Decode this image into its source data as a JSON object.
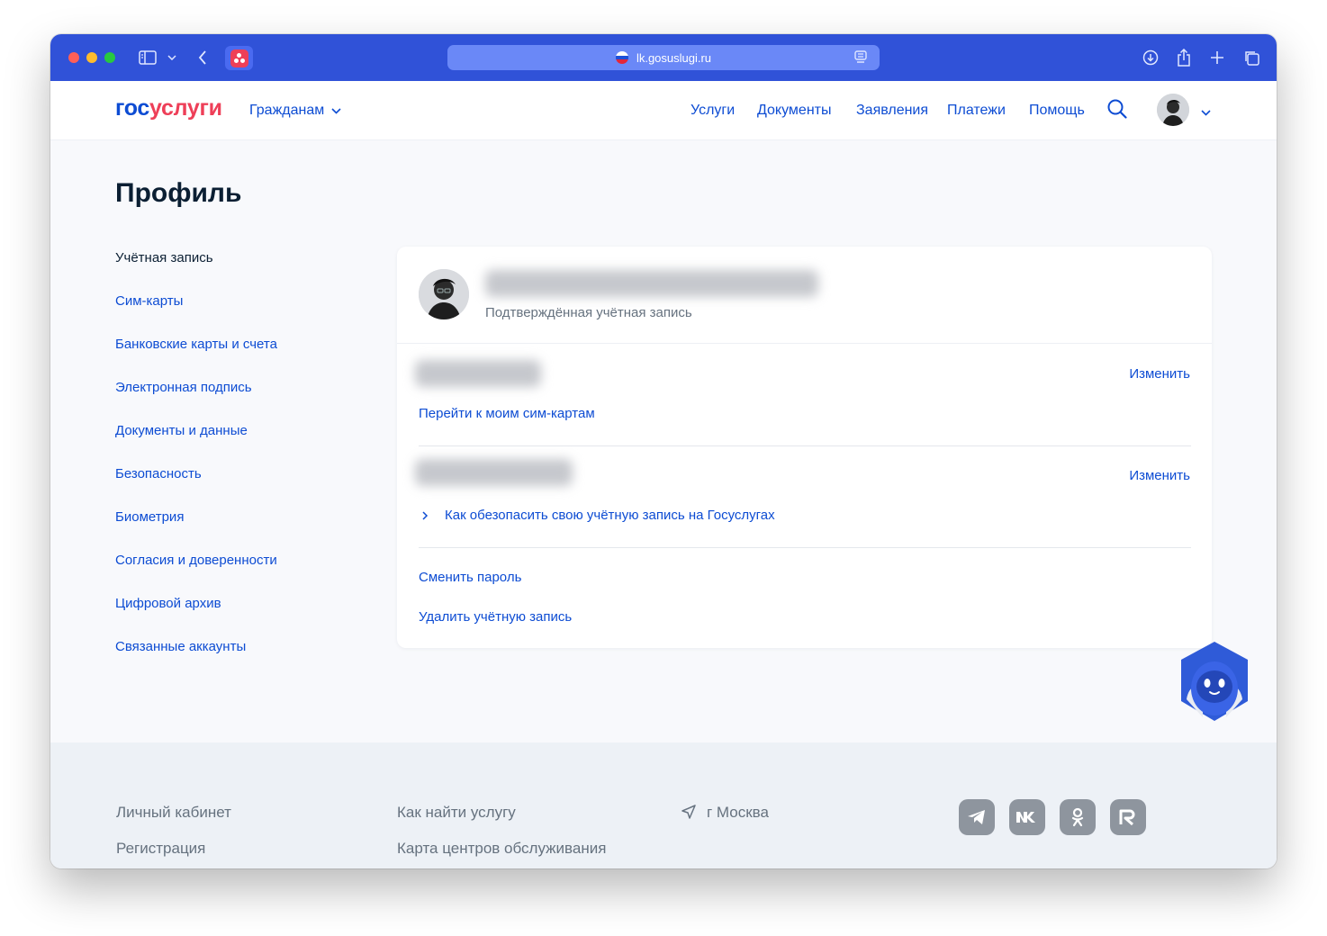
{
  "browser": {
    "url": "lk.gosuslugi.ru"
  },
  "header": {
    "logo_part1": "гос",
    "logo_part2": "услуги",
    "audience": "Гражданам",
    "nav": [
      "Услуги",
      "Документы",
      "Заявления",
      "Платежи",
      "Помощь"
    ]
  },
  "profile": {
    "title": "Профиль",
    "sidebar": [
      "Учётная запись",
      "Сим-карты",
      "Банковские карты и счета",
      "Электронная подпись",
      "Документы и данные",
      "Безопасность",
      "Биометрия",
      "Согласия и доверенности",
      "Цифровой архив",
      "Связанные аккаунты"
    ],
    "account_status": "Подтверждённая учётная запись",
    "change_label": "Изменить",
    "sim_link": "Перейти к моим сим-картам",
    "secure_link": "Как обезопасить свою учётную запись на Госуслугах",
    "change_password": "Сменить пароль",
    "delete_account": "Удалить учётную запись"
  },
  "footer": {
    "col1": [
      "Личный кабинет",
      "Регистрация"
    ],
    "col2": [
      "Как найти услугу",
      "Карта центров обслуживания"
    ],
    "city": "г Москва",
    "social_icons": [
      "telegram-icon",
      "vk-icon",
      "ok-icon",
      "rutube-icon"
    ]
  },
  "colors": {
    "accent": "#0d4cd3",
    "brand_red": "#ee3f58",
    "browser_bar": "#3052d8"
  }
}
